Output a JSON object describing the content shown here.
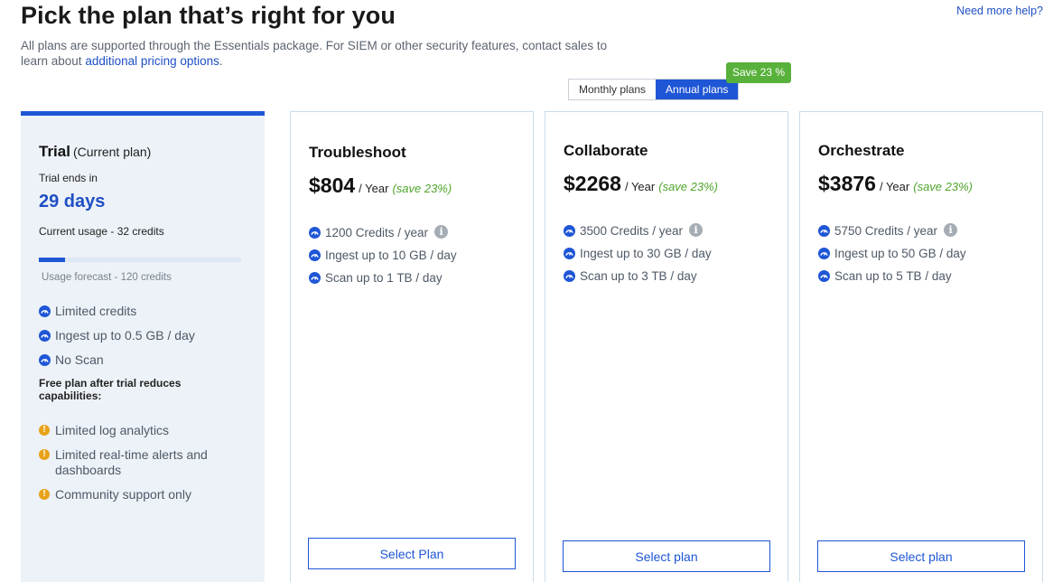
{
  "header": {
    "title": "Pick the plan that’s right for you",
    "help_link": "Need more help?",
    "subtitle_text": "All plans are supported through the Essentials package. For SIEM or other security features, contact sales to learn about ",
    "subtitle_link": "additional pricing options",
    "subtitle_end": "."
  },
  "billing_toggle": {
    "monthly_label": "Monthly plans",
    "annual_label": "Annual plans",
    "selected": "annual",
    "save_badge": "Save 23 %"
  },
  "trial": {
    "title": "Trial",
    "current_label": "(Current plan)",
    "ends_label": "Trial ends in",
    "days": "29 days",
    "usage": "Current usage - 32 credits",
    "usage_fraction": 0.13,
    "forecast": "Usage forecast - 120 credits",
    "features": [
      "Limited credits",
      "Ingest up to 0.5 GB / day",
      "No Scan"
    ],
    "free_heading": "Free plan after trial reduces capabilities:",
    "warnings": [
      "Limited log analytics",
      "Limited real-time alerts and dashboards",
      "Community support only"
    ]
  },
  "plans": [
    {
      "name": "Troubleshoot",
      "price": "$804",
      "period": "/ Year",
      "save": "(save 23%)",
      "features": [
        "1200 Credits / year",
        "Ingest up to 10 GB / day",
        "Scan up to 1 TB / day"
      ],
      "button": "Select Plan"
    },
    {
      "name": "Collaborate",
      "price": "$2268",
      "period": "/ Year",
      "save": "(save 23%)",
      "features": [
        "3500 Credits / year",
        "Ingest up to 30 GB / day",
        "Scan up to 3 TB / day"
      ],
      "button": "Select plan"
    },
    {
      "name": "Orchestrate",
      "price": "$3876",
      "period": "/ Year",
      "save": "(save 23%)",
      "features": [
        "5750 Credits / year",
        "Ingest up to 50 GB / day",
        "Scan up to 5 TB / day"
      ],
      "button": "Select plan"
    }
  ],
  "icons": {
    "feature": "gauge-icon",
    "warning": "warning-icon",
    "info": "info-icon"
  },
  "colors": {
    "accent": "#1e56d6",
    "save_green": "#58b13a",
    "warning": "#e8a21a",
    "trial_bg": "#edf2f8"
  }
}
